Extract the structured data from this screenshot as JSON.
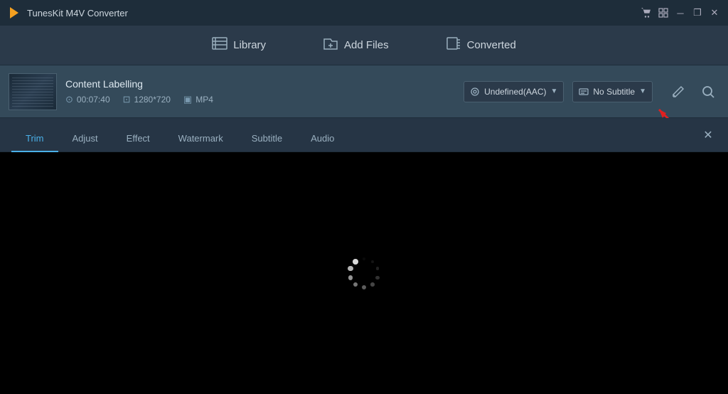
{
  "app": {
    "title": "TunesKit M4V Converter",
    "logo_color": "#f4a020"
  },
  "titlebar": {
    "minimize_label": "─",
    "restore_label": "❐",
    "close_label": "✕",
    "shopping_icon": "🛒",
    "window_icon": "⊡"
  },
  "nav": {
    "library_label": "Library",
    "add_files_label": "Add Files",
    "converted_label": "Converted"
  },
  "content": {
    "file_name": "Content Labelling",
    "duration": "00:07:40",
    "resolution": "1280*720",
    "format": "MP4",
    "audio": "Undefined(AAC)",
    "subtitle": "No Subtitle"
  },
  "editor": {
    "close_label": "✕",
    "tabs": [
      {
        "label": "Trim",
        "active": true
      },
      {
        "label": "Adjust",
        "active": false
      },
      {
        "label": "Effect",
        "active": false
      },
      {
        "label": "Watermark",
        "active": false
      },
      {
        "label": "Subtitle",
        "active": false
      },
      {
        "label": "Audio",
        "active": false
      }
    ]
  },
  "colors": {
    "accent": "#4ab0e8",
    "red_arrow": "#e02020",
    "bg_dark": "#1e2d3a",
    "bg_mid": "#2b3a4a",
    "bg_light": "#344a5a"
  }
}
